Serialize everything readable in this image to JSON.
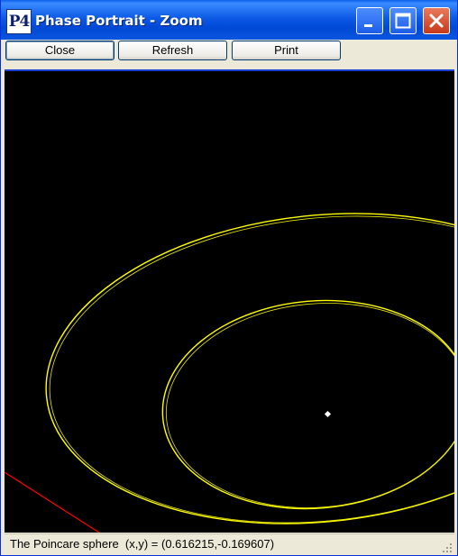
{
  "window": {
    "title": "Phase Portrait - Zoom",
    "icon_text": "P4",
    "controls": [
      "minimize-icon",
      "maximize-icon",
      "close-icon"
    ]
  },
  "toolbar": {
    "close_label": "Close",
    "refresh_label": "Refresh",
    "print_label": "Print"
  },
  "plot": {
    "background": "#000000",
    "orbit_color": "#ffff00",
    "separatrix_color": "#ff0000",
    "singular_point_color": "#ffffff"
  },
  "status": {
    "text": "The Poincare sphere  (x,y) = (0.616215,-0.169607)"
  }
}
